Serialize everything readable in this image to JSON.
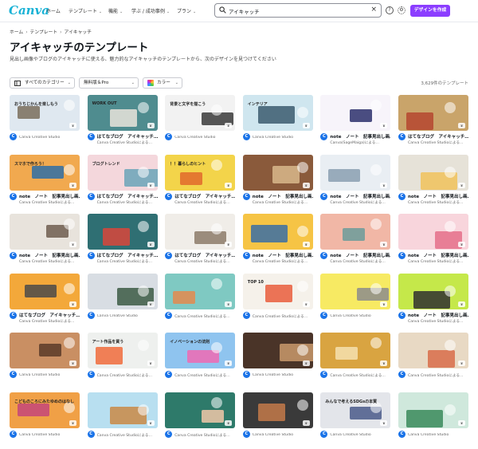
{
  "header": {
    "logo": "Canva",
    "nav": [
      {
        "label": "ホーム",
        "has_menu": false
      },
      {
        "label": "テンプレート",
        "has_menu": true
      },
      {
        "label": "機能",
        "has_menu": true
      },
      {
        "label": "学ぶ / 成功事例",
        "has_menu": true
      },
      {
        "label": "プラン",
        "has_menu": true
      }
    ],
    "search": {
      "value": "アイキャッチ",
      "clear_icon": "close-icon"
    },
    "help_icon": "?",
    "settings_icon": "gear-icon",
    "create_label": "デザインを作成",
    "accent": "#8b3dff"
  },
  "breadcrumb": [
    "ホーム",
    "テンプレート",
    "アイキャッチ"
  ],
  "page": {
    "title": "アイキャッチのテンプレート",
    "subtitle": "見出し画像やブログのアイキャッチに使える、魅力的なアイキャッチのテンプレートから、次のデザインを見つけてください"
  },
  "filters": [
    {
      "label": "すべてのカテゴリー",
      "icon": "category-icon"
    },
    {
      "label": "無料版＆Pro",
      "icon": ""
    },
    {
      "label": "カラー",
      "icon": "color-icon"
    }
  ],
  "result_count": "3,629件のテンプレート",
  "cards": [
    {
      "title": "",
      "author": "Canva Creative Studio",
      "thumb": "おうちじかんを楽しもう",
      "bg": "#dfe8f0",
      "accent": "#7a6d5c",
      "avatar": "C"
    },
    {
      "title": "はてなブログ　アイキャッチ…",
      "author": "Canva Creative Studioによる…",
      "thumb": "WORK OUT",
      "bg": "#4f8c8f",
      "accent": "#e9e4dc",
      "avatar": "C"
    },
    {
      "title": "",
      "author": "Canva Creative Studio",
      "thumb": "背景と文字を描こう",
      "bg": "#f2f2f2",
      "accent": "#3a3a3a",
      "avatar": "C"
    },
    {
      "title": "",
      "author": "Canva Creative Studio",
      "thumb": "インテリア",
      "bg": "#cfe6ef",
      "accent": "#3b5b6e",
      "avatar": "C"
    },
    {
      "title": "note　ノート　記事見出し画…",
      "author": "Canva(SageMaiga)による…",
      "thumb": "",
      "bg": "#f7f4fa",
      "accent": "#2b2f6b",
      "avatar": "C"
    },
    {
      "title": "はてなブログ　アイキャッチ…",
      "author": "Canva Creative Studioによる…",
      "thumb": "",
      "bg": "#c9a46a",
      "accent": "#b5462f",
      "avatar": "C"
    },
    {
      "title": "note　ノート　記事見出し画…",
      "author": "Canva Creative Studioによる…",
      "thumb": "スマホで作ろう！",
      "bg": "#f1a94f",
      "accent": "#2e6ea6",
      "avatar": "C"
    },
    {
      "title": "はてなブログ　アイキャッチ…",
      "author": "Canva Creative Studioによる…",
      "thumb": "ブログトレンド",
      "bg": "#f4d7dc",
      "accent": "#6aa4b8",
      "avatar": "C"
    },
    {
      "title": "はてなブログ　アイキャッチ…",
      "author": "Canva Creative Studioによる…",
      "thumb": "！！暮らしのヒント",
      "bg": "#f3d44a",
      "accent": "#e0692b",
      "avatar": "C"
    },
    {
      "title": "note　ノート　記事見出し画…",
      "author": "Canva Creative Studioによる…",
      "thumb": "",
      "bg": "#8a5a3b",
      "accent": "#d8b98c",
      "avatar": "C"
    },
    {
      "title": "note　ノート　記事見出し画…",
      "author": "Canva Creative Studioによる…",
      "thumb": "",
      "bg": "#e9eef3",
      "accent": "#8a9fb0",
      "avatar": "C"
    },
    {
      "title": "note　ノート　記事見出し画…",
      "author": "Canva Creative Studioによる…",
      "thumb": "",
      "bg": "#e6e2d8",
      "accent": "#f0c25c",
      "avatar": "C"
    },
    {
      "title": "note　ノート　記事見出し画…",
      "author": "Canva Creative Studioによる…",
      "thumb": "",
      "bg": "#e8e3dc",
      "accent": "#6e5d4f",
      "avatar": "C"
    },
    {
      "title": "はてなブログ　アイキャッチ…",
      "author": "Canva Creative Studioによる…",
      "thumb": "",
      "bg": "#2f6f73",
      "accent": "#d9473b",
      "avatar": "C"
    },
    {
      "title": "はてなブログ　アイキャッチ…",
      "author": "Canva Creative Studioによる…",
      "thumb": "",
      "bg": "#f0ede8",
      "accent": "#8c7a68",
      "avatar": "C"
    },
    {
      "title": "note　ノート　記事見出し画…",
      "author": "Canva Creative Studioによる…",
      "thumb": "",
      "bg": "#f6c445",
      "accent": "#3a6ea5",
      "avatar": "C"
    },
    {
      "title": "note　ノート　記事見出し画…",
      "author": "Canva Creative Studioによる…",
      "thumb": "",
      "bg": "#f1b7a6",
      "accent": "#6b9c9a",
      "avatar": "C"
    },
    {
      "title": "note　ノート　記事見出し画…",
      "author": "Canva Creative Studioによる…",
      "thumb": "",
      "bg": "#f8d5dc",
      "accent": "#e56e8a",
      "avatar": "C"
    },
    {
      "title": "はてなブログ　アイキャッチ…",
      "author": "Canva Creative Studioによる…",
      "thumb": "",
      "bg": "#f3a83a",
      "accent": "#4a4a4a",
      "avatar": "C"
    },
    {
      "title": "",
      "author": "Canva Creative Studio",
      "thumb": "",
      "bg": "#d8dde3",
      "accent": "#3c5a44",
      "avatar": "C"
    },
    {
      "title": "",
      "author": "Canva Creative Studioによる…",
      "thumb": "",
      "bg": "#7fc9c2",
      "accent": "#e48a4d",
      "avatar": "C"
    },
    {
      "title": "",
      "author": "Canva Creative Studioによる…",
      "thumb": "TOP 10",
      "bg": "#f5f1ea",
      "accent": "#e95d3c",
      "avatar": "C"
    },
    {
      "title": "",
      "author": "Canva Creative Studio",
      "thumb": "",
      "bg": "#f7ea63",
      "accent": "#8c8c8c",
      "avatar": "C"
    },
    {
      "title": "note　ノート　記事見出し画…",
      "author": "Canva Creative Studioによる…",
      "thumb": "",
      "bg": "#c5e84a",
      "accent": "#2f2f2f",
      "avatar": "C"
    },
    {
      "title": "",
      "author": "Canva Creative Studio",
      "thumb": "",
      "bg": "#c98f63",
      "accent": "#5a3b28",
      "avatar": "C"
    },
    {
      "title": "",
      "author": "Canva Creative Studioによる…",
      "thumb": "アート作品を買う",
      "bg": "#eef0ee",
      "accent": "#f06b3b",
      "avatar": "C"
    },
    {
      "title": "",
      "author": "Canva Creative Studioによる…",
      "thumb": "イノベーションの法則",
      "bg": "#8fc4ef",
      "accent": "#f06ab3",
      "avatar": "C"
    },
    {
      "title": "",
      "author": "Canva Creative Studio",
      "thumb": "",
      "bg": "#4a3428",
      "accent": "#c99a6b",
      "avatar": "C"
    },
    {
      "title": "",
      "author": "Canva Creative Studioによる…",
      "thumb": "",
      "bg": "#d9a441",
      "accent": "#f5e2b0",
      "avatar": "C"
    },
    {
      "title": "",
      "author": "Canva Creative Studioによる…",
      "thumb": "",
      "bg": "#e8d9c4",
      "accent": "#d86c4a",
      "avatar": "C"
    },
    {
      "title": "",
      "author": "Canva Creative Studio",
      "thumb": "こどものころにみたゆめのはなし",
      "bg": "#f0a046",
      "accent": "#c4457a",
      "avatar": "C"
    },
    {
      "title": "",
      "author": "Canva Creative Studioによる…",
      "thumb": "",
      "bg": "#b8dff0",
      "accent": "#c98a45",
      "avatar": "C"
    },
    {
      "title": "",
      "author": "Canva Creative Studioによる…",
      "thumb": "",
      "bg": "#2e7a6a",
      "accent": "#f0c8a8",
      "avatar": "C"
    },
    {
      "title": "",
      "author": "Canva Creative Studio",
      "thumb": "",
      "bg": "#3a3a3a",
      "accent": "#c47a4a",
      "avatar": "C"
    },
    {
      "title": "",
      "author": "Canva Creative Studio",
      "thumb": "みんなで考えるSDGsの本質",
      "bg": "#e3e5ea",
      "accent": "#4a5b8a",
      "avatar": "C"
    },
    {
      "title": "",
      "author": "Canva Creative Studio",
      "thumb": "",
      "bg": "#cfe8dc",
      "accent": "#3a8a5a",
      "avatar": "C"
    }
  ]
}
